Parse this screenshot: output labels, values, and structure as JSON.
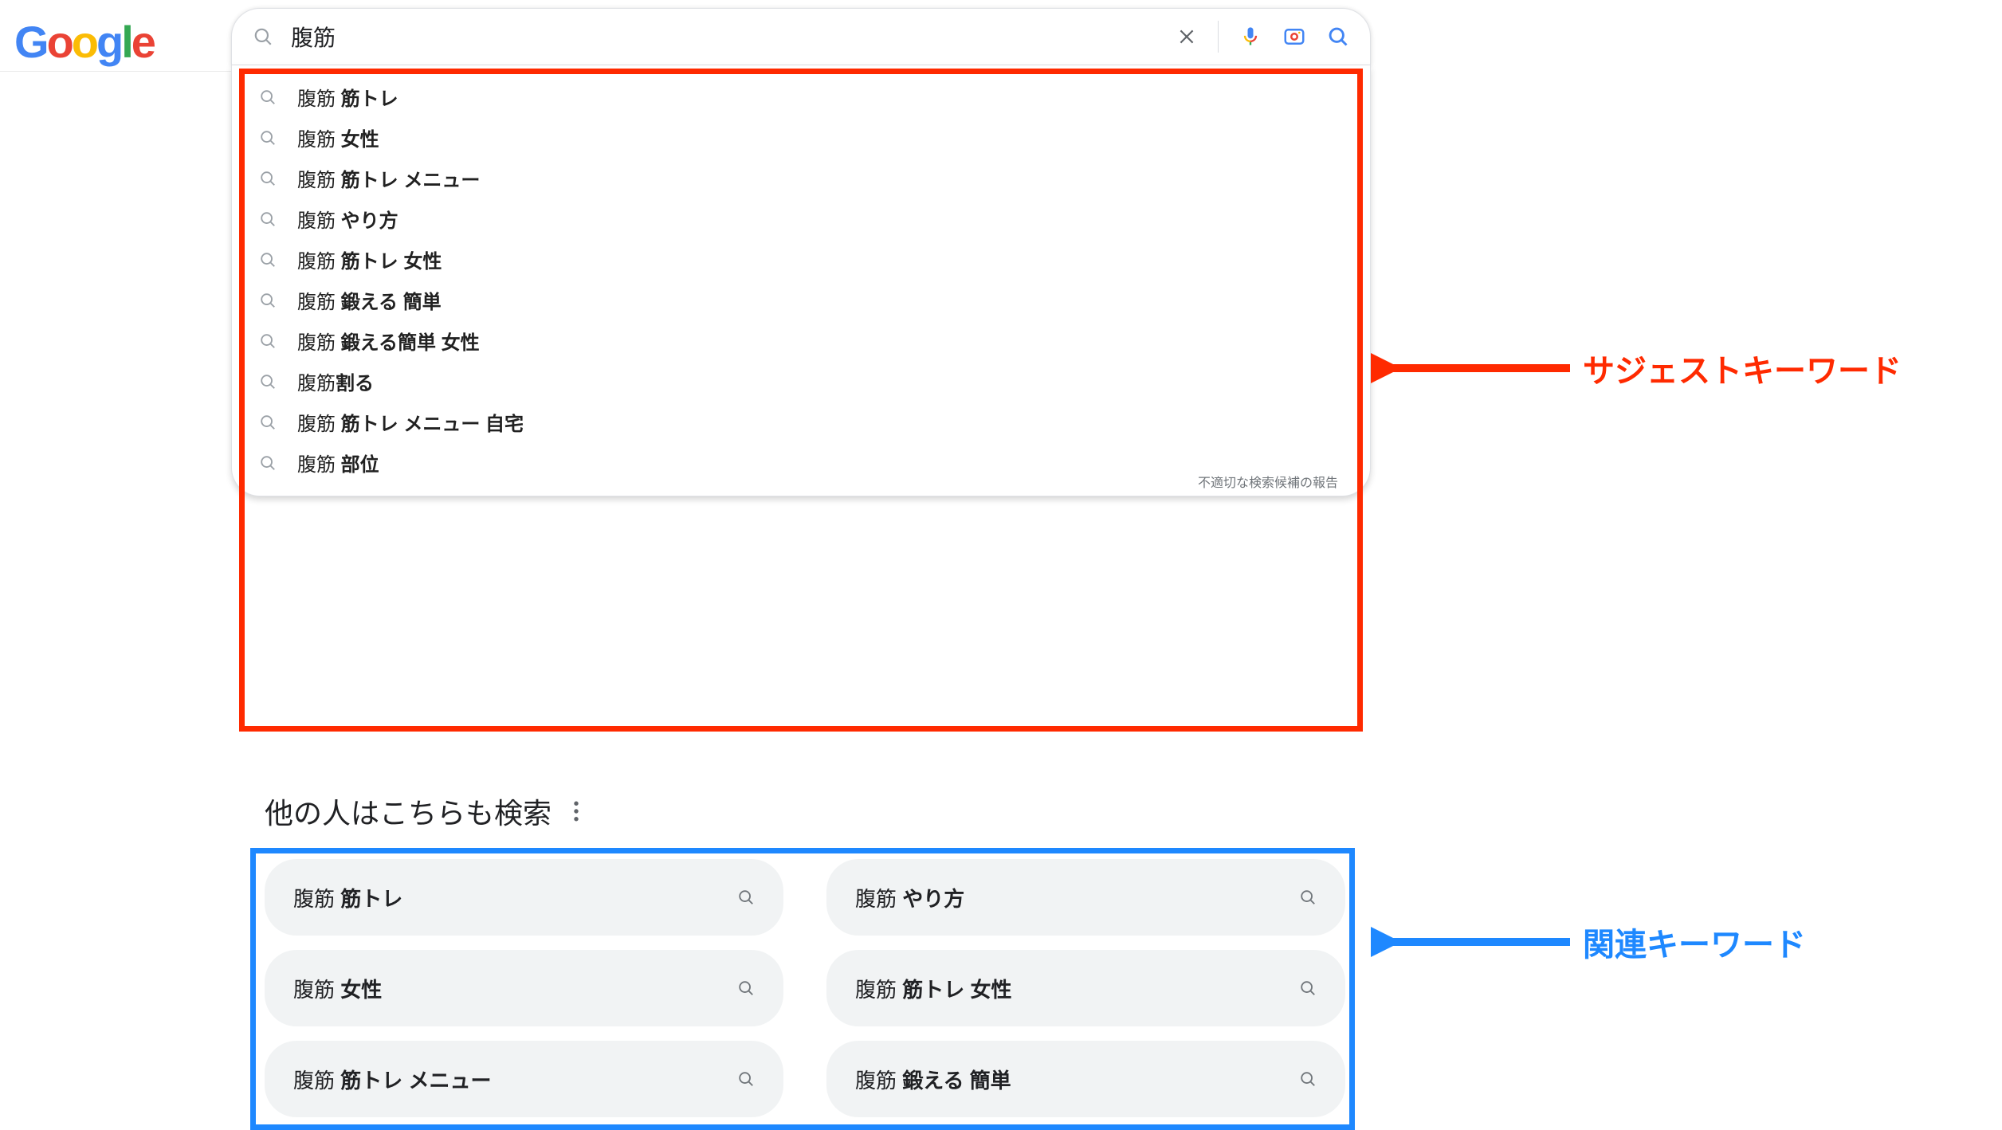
{
  "logo": {
    "letters": [
      "G",
      "o",
      "o",
      "g",
      "l",
      "e"
    ]
  },
  "search": {
    "query": "腹筋"
  },
  "suggestions": [
    {
      "prefix": "腹筋 ",
      "bold": "筋トレ"
    },
    {
      "prefix": "腹筋 ",
      "bold": "女性"
    },
    {
      "prefix": "腹筋 ",
      "bold": "筋トレ メニュー"
    },
    {
      "prefix": "腹筋 ",
      "bold": "やり方"
    },
    {
      "prefix": "腹筋 ",
      "bold": "筋トレ 女性"
    },
    {
      "prefix": "腹筋 ",
      "bold": "鍛える 簡単"
    },
    {
      "prefix": "腹筋 ",
      "bold": "鍛える簡単 女性"
    },
    {
      "prefix": "腹筋",
      "bold": "割る"
    },
    {
      "prefix": "腹筋 ",
      "bold": "筋トレ メニュー 自宅"
    },
    {
      "prefix": "腹筋 ",
      "bold": "部位"
    }
  ],
  "report_text": "不適切な検索候補の報告",
  "related": {
    "heading": "他の人はこちらも検索",
    "items": [
      {
        "prefix": "腹筋 ",
        "bold": "筋トレ"
      },
      {
        "prefix": "腹筋 ",
        "bold": "やり方"
      },
      {
        "prefix": "腹筋 ",
        "bold": "女性"
      },
      {
        "prefix": "腹筋 ",
        "bold": "筋トレ 女性"
      },
      {
        "prefix": "腹筋 ",
        "bold": "筋トレ メニュー"
      },
      {
        "prefix": "腹筋 ",
        "bold": "鍛える 簡単"
      }
    ]
  },
  "annotations": {
    "suggest_label": "サジェストキーワード",
    "related_label": "関連キーワード"
  }
}
